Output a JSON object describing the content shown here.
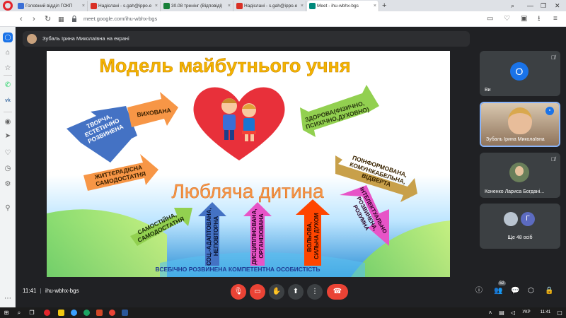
{
  "browser": {
    "tabs": [
      {
        "label": "Головний відділ ГОКП",
        "color": "#3b6fd6"
      },
      {
        "label": "Надіслані - s.gah@ippo.e",
        "color": "#d93025"
      },
      {
        "label": "30.08 тренінг (Відповіді)",
        "color": "#188038"
      },
      {
        "label": "Надіслані - s.gah@ippo.e",
        "color": "#d93025"
      },
      {
        "label": "Meet - ihu-wbhx-bgs",
        "color": "#00897b"
      }
    ],
    "new_tab": "+",
    "url": "meet.google.com/ihu-wbhx-bgs"
  },
  "meet": {
    "presenting_text": "Зубаль Ірина Миколаївна на екрані",
    "participants": [
      {
        "name": "Ви",
        "initial": "О",
        "avatar_color": "#1a73e8"
      },
      {
        "name": "Зубаль Ірина Миколаївна"
      },
      {
        "name": "Коненко Лариса Богдані..."
      },
      {
        "name": "Ще 48 осіб",
        "initial": "Г",
        "avatar_color": "#5c6bc0"
      }
    ],
    "time": "11:41",
    "separator": "|",
    "meeting_code": "ihu-wbhx-bgs",
    "people_count": "52"
  },
  "slide": {
    "title": "Модель майбутнього учня",
    "center": "Любляча дитина",
    "footer": "ВСЕБІЧНО РОЗВИНЕНА КОМПЕТЕНТНА ОСОБИСТІСТЬ",
    "arrows": {
      "tvorcha": [
        "ТВОРЧА,",
        "ЕСТЕТИЧНО",
        "РОЗВИНЕНА"
      ],
      "vykhovana": [
        "ВИХОВАНА"
      ],
      "zdorova": [
        "ЗДОРОВА(ФІЗИЧНО,",
        "ПСИХІЧНО,ДУХОВНО)"
      ],
      "poinformovana": [
        "ПОІНФОРМОВАНА,",
        "КОМУНІКАБЕЛЬНА,",
        "ВІДВЕРТА"
      ],
      "zhyttieradisna": [
        "ЖИТТЄРАДІСНА",
        "САМОДОСТАТНЯ"
      ],
      "intelektualno": [
        "ІНТЕЛЕКТУАЛЬНО",
        "РОЗВИНЕНА,",
        "РОЗУМНА"
      ],
      "samostiina": [
        "САМОСТІЙНА,",
        "САМОДОСТАТНЯ"
      ],
      "sots_adaptovana": [
        "СОЦ.-АДАПТОВАНА,",
        "НЕПОВТОРНА"
      ],
      "dystsyplinovana": [
        "ДИСЦИПЛІНОВАНА,",
        "ОРГАНІЗОВАНА"
      ],
      "volova": [
        "ВОЛЬОВА,",
        "СИЛЬНА ДУХОМ"
      ]
    }
  },
  "taskbar": {
    "lang": "УКР",
    "time": "11:41"
  },
  "colors": {
    "title_yellow": "#f4b400",
    "center_orange": "#f79646",
    "arrow_blue": "#4472c4",
    "arrow_orange": "#f79646",
    "arrow_green": "#92d050",
    "arrow_brown": "#b8860b",
    "arrow_pink": "#e754c7",
    "arrow_red": "#ff4500",
    "heart": "#e8303a"
  }
}
